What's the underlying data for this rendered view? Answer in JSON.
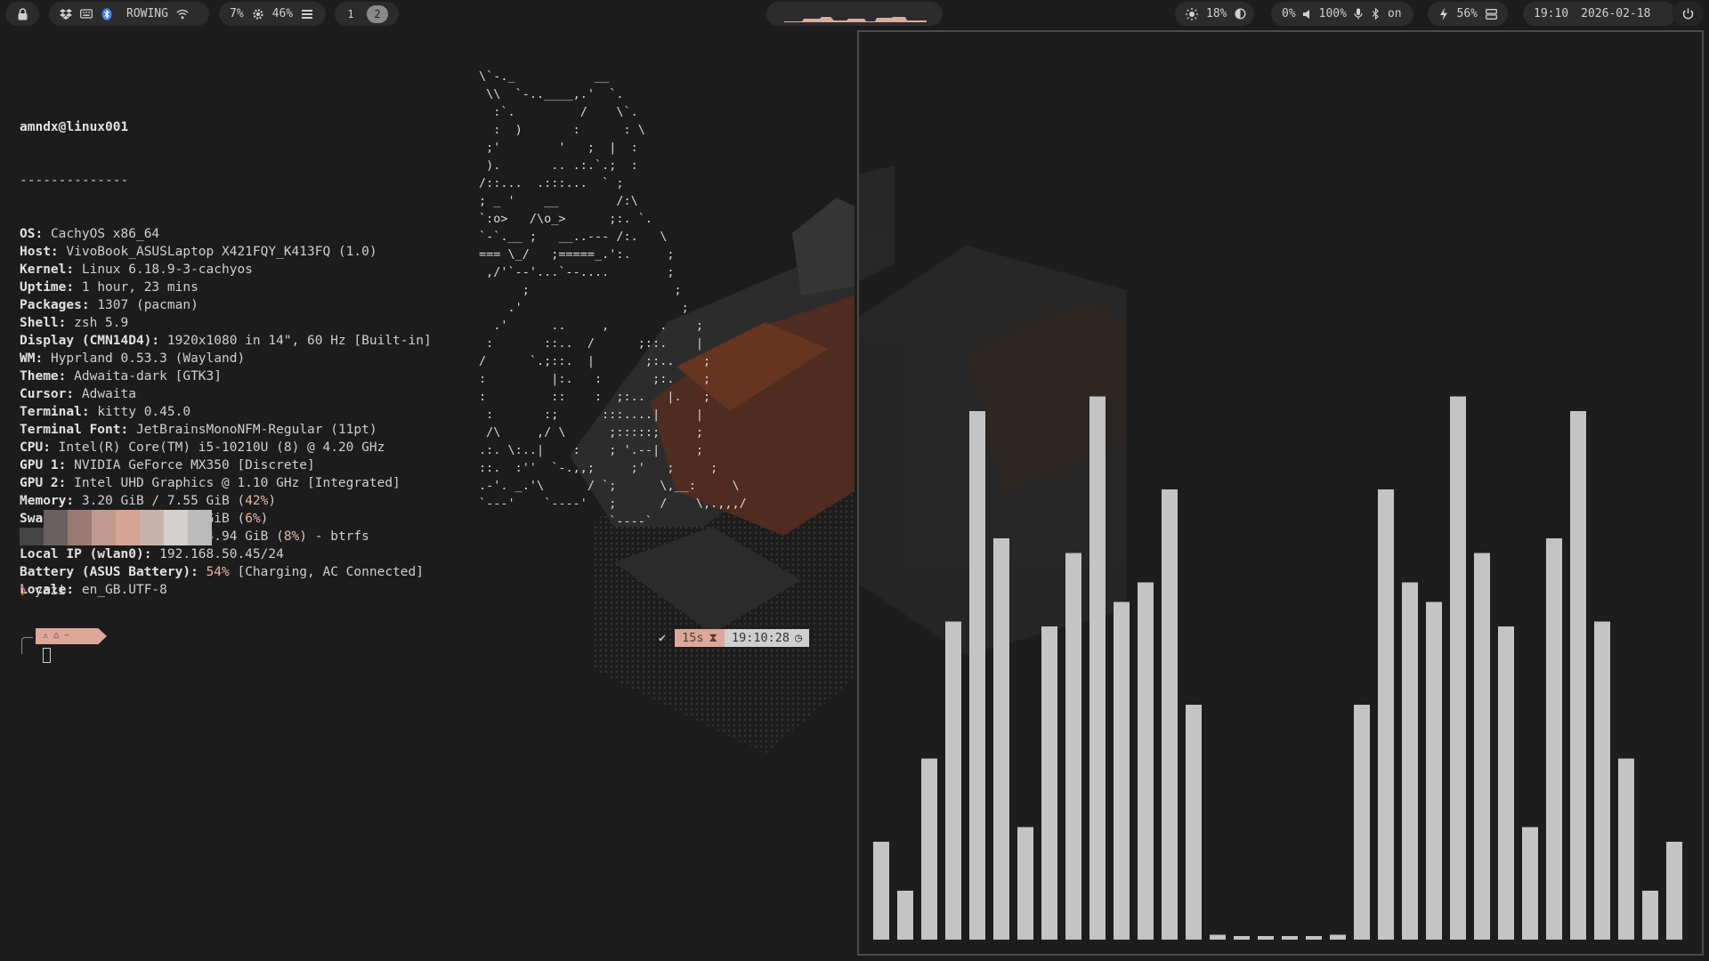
{
  "topbar": {
    "left": {
      "lock_icon": "lock-icon",
      "network_label": "ROWING",
      "cpu": "7%",
      "memory": "46%"
    },
    "workspaces": [
      {
        "label": "1",
        "active": false
      },
      {
        "label": "2",
        "active": true
      }
    ],
    "right": {
      "brightness": "18%",
      "volume_in": "0%",
      "volume_out": "100%",
      "bluetooth": "on",
      "battery": "56%",
      "time": "19:10",
      "date": "2026-02-18"
    },
    "colors": {
      "pill_bg": "#2c2c2c",
      "accent": "#dda899"
    }
  },
  "terminal": {
    "user_host": "amndx@linux001",
    "separator": "--------------",
    "info": [
      {
        "key": "OS",
        "value": "CachyOS x86_64"
      },
      {
        "key": "Host",
        "value": "VivoBook_ASUSLaptop X421FQY_K413FQ (1.0)"
      },
      {
        "key": "Kernel",
        "value": "Linux 6.18.9-3-cachyos"
      },
      {
        "key": "Uptime",
        "value": "1 hour, 23 mins"
      },
      {
        "key": "Packages",
        "value": "1307 (pacman)"
      },
      {
        "key": "Shell",
        "value": "zsh 5.9"
      },
      {
        "key": "Display (CMN14D4)",
        "value": "1920x1080 in 14\", 60 Hz [Built-in]"
      },
      {
        "key": "WM",
        "value": "Hyprland 0.53.3 (Wayland)"
      },
      {
        "key": "Theme",
        "value": "Adwaita-dark [GTK3]"
      },
      {
        "key": "Cursor",
        "value": "Adwaita"
      },
      {
        "key": "Terminal",
        "value": "kitty 0.45.0"
      },
      {
        "key": "Terminal Font",
        "value": "JetBrainsMonoNFM-Regular (11pt)"
      },
      {
        "key": "CPU",
        "value": "Intel(R) Core(TM) i5-10210U (8) @ 4.20 GHz"
      },
      {
        "key": "GPU 1",
        "value": "NVIDIA GeForce MX350 [Discrete]"
      },
      {
        "key": "GPU 2",
        "value": "Intel UHD Graphics @ 1.10 GHz [Integrated]"
      },
      {
        "key": "Memory",
        "value": "3.20 GiB / 7.55 GiB (",
        "pct": "42%",
        "tail": ")"
      },
      {
        "key": "Swap",
        "value": "427.98 MiB / 7.55 GiB (",
        "pct": "6%",
        "tail": ")"
      },
      {
        "key": "Disk (/)",
        "value": "39.42 GiB / 474.94 GiB (",
        "pct": "8%",
        "tail": ") - btrfs"
      },
      {
        "key": "Local IP (wlan0)",
        "value": "192.168.50.45/24"
      },
      {
        "key": "Battery (ASUS Battery)",
        "value": "",
        "pct": "54%",
        "tail": " [Charging, AC Connected]"
      },
      {
        "key": "Locale",
        "value": "en_GB.UTF-8"
      }
    ],
    "swatches": [
      "#444444",
      "#6a6060",
      "#9a7a72",
      "#c09a8e",
      "#d4a496",
      "#c9b2aa",
      "#d6d0ce",
      "#bbbbbb"
    ],
    "command": "yazi",
    "prompt_symbol": "❯",
    "prompt_segment": "⚠ ⌂ ~",
    "right_prompt": {
      "check": "✔",
      "duration": "15s",
      "clock": "19:10:28"
    },
    "ascii_art": "\\`-._           __\n \\\\  `-..____,.'  `.\n  :`.         /    \\`.\n  :  )       :      : \\\n ;'        '   ;  |  :\n ).       .. .:.`.;  :\n/::...  .:::...  ` ;\n; _ '    __        /:\\\n`:o>   /\\o_>      ;:. `.\n`-`.__ ;   __..--- /:.   \\\n=== \\_/   ;=====_.':.     ;\n ,/'`--'...`--....        ;\n      ;                    ;\n    .'                      ;\n  .'      ..     ,       .    ;\n :       ::..  /      ;::.    |\n/      `.;::.  |       ;:..    ;\n:         |:.   :       ;:.    ;\n:         ::    :  ;:..   |.   ;\n :       :;      :::....|     |\n /\\     ,/ \\      ;:::::;     ;\n.:. \\:..|    :    ; '.--|     ;\n::.  :''  `-.,,;     ;'   ;     ;\n.-'. _.'\\      / `;      \\,__:     \\\n`---'    `----'   ;      /    \\,.,,,/\n                  `----`"
  },
  "visualizer": {
    "bar_levels": [
      0.2,
      0.1,
      0.37,
      0.65,
      1.08,
      0.82,
      0.23,
      0.64,
      0.79,
      1.11,
      0.69,
      0.73,
      0.92,
      0.48,
      0.01,
      0.0,
      0.0,
      0.0,
      0.0,
      0.01,
      0.48,
      0.92,
      0.73,
      0.69,
      1.11,
      0.79,
      0.64,
      0.23,
      0.82,
      1.08,
      0.65,
      0.37,
      0.1,
      0.2
    ],
    "bar_color": "#c4c4c4"
  }
}
